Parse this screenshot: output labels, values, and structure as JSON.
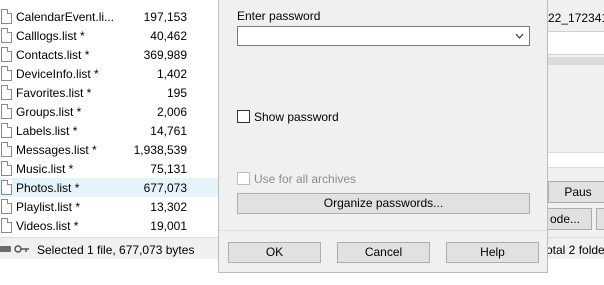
{
  "files": [
    {
      "name": "CalendarEvent.li...",
      "size": "197,153",
      "selected": false
    },
    {
      "name": "Calllogs.list *",
      "size": "40,462",
      "selected": false
    },
    {
      "name": "Contacts.list *",
      "size": "369,989",
      "selected": false
    },
    {
      "name": "DeviceInfo.list *",
      "size": "1,402",
      "selected": false
    },
    {
      "name": "Favorites.list *",
      "size": "195",
      "selected": false
    },
    {
      "name": "Groups.list *",
      "size": "2,006",
      "selected": false
    },
    {
      "name": "Labels.list *",
      "size": "14,761",
      "selected": false
    },
    {
      "name": "Messages.list *",
      "size": "1,938,539",
      "selected": false
    },
    {
      "name": "Music.list *",
      "size": "75,131",
      "selected": false
    },
    {
      "name": "Photos.list *",
      "size": "677,073",
      "selected": true
    },
    {
      "name": "Playlist.list *",
      "size": "13,302",
      "selected": false
    },
    {
      "name": "Videos.list *",
      "size": "19,001",
      "selected": false
    }
  ],
  "status": {
    "text": "Selected 1 file, 677,073 bytes",
    "right_text": "otal 2 folde"
  },
  "background": {
    "top_right_text": "22_172341",
    "pause_label": "Paus",
    "mode_label": "ode...",
    "icons": [
      "drive-icon",
      "key-icon"
    ]
  },
  "dialog": {
    "password_label": "Enter password",
    "password_value": "",
    "show_password_label": "Show password",
    "show_password_checked": false,
    "use_for_all_label": "Use for all archives",
    "use_for_all_checked": false,
    "organize_label": "Organize passwords...",
    "ok_label": "OK",
    "cancel_label": "Cancel",
    "help_label": "Help"
  },
  "colors": {
    "selected_row": "#e5f3fb",
    "dialog_bg": "#f0f0f0",
    "button_bg": "#e1e1e1",
    "disabled_text": "#8d8d8d"
  }
}
